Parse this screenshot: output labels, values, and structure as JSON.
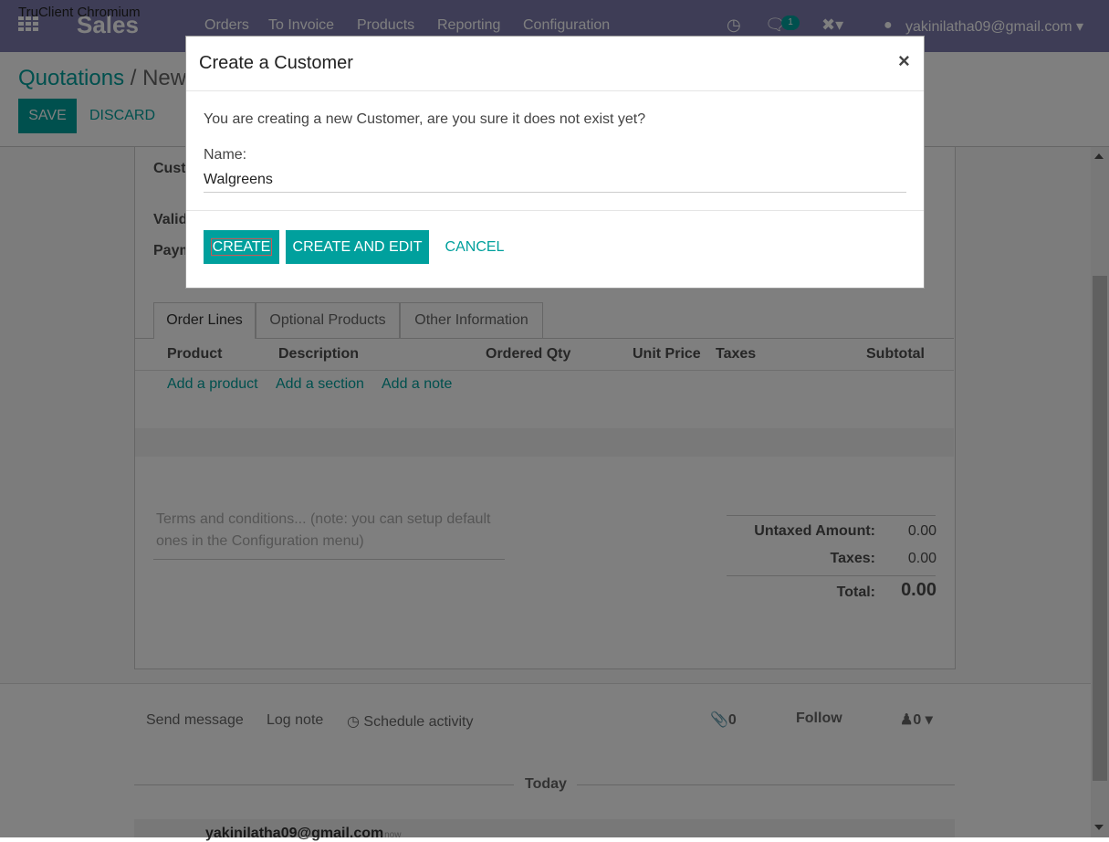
{
  "overlay_label": "TruClient Chromium",
  "navbar": {
    "app_name": "Sales",
    "menu": [
      "Orders",
      "To Invoice",
      "Products",
      "Reporting",
      "Configuration"
    ],
    "messages_count": "1",
    "user": "yakinilatha09@gmail.com"
  },
  "breadcrumb": {
    "parent": "Quotations",
    "separator": "/",
    "current": "New"
  },
  "buttons": {
    "save": "Save",
    "discard": "Discard"
  },
  "form": {
    "labels": [
      "Custo",
      "Valid",
      "Paym"
    ],
    "tabs": [
      "Order Lines",
      "Optional Products",
      "Other Information"
    ],
    "columns": [
      "Product",
      "Description",
      "Ordered Qty",
      "Unit Price",
      "Taxes",
      "Subtotal"
    ],
    "add_links": [
      "Add a product",
      "Add a section",
      "Add a note"
    ],
    "terms_placeholder": "Terms and conditions... (note: you can setup default ones in the Configuration menu)"
  },
  "totals": {
    "untaxed_label": "Untaxed Amount:",
    "untaxed_value": "0.00",
    "taxes_label": "Taxes:",
    "taxes_value": "0.00",
    "total_label": "Total:",
    "total_value": "0.00"
  },
  "chatter": {
    "send_message": "Send message",
    "log_note": "Log note",
    "schedule_activity": "Schedule activity",
    "attachments_count": "0",
    "follow": "Follow",
    "followers_count": "0",
    "today": "Today",
    "message_author": "yakinilatha09@gmail.com",
    "message_time": "- now"
  },
  "modal": {
    "title": "Create a Customer",
    "close": "×",
    "message": "You are creating a new Customer, are you sure it does not exist yet?",
    "name_label": "Name:",
    "name_value": "Walgreens",
    "create": "Create",
    "create_and_edit": "Create and Edit",
    "cancel": "Cancel"
  },
  "colors": {
    "navbar": "#7c7bad",
    "accent": "#00a09d"
  }
}
